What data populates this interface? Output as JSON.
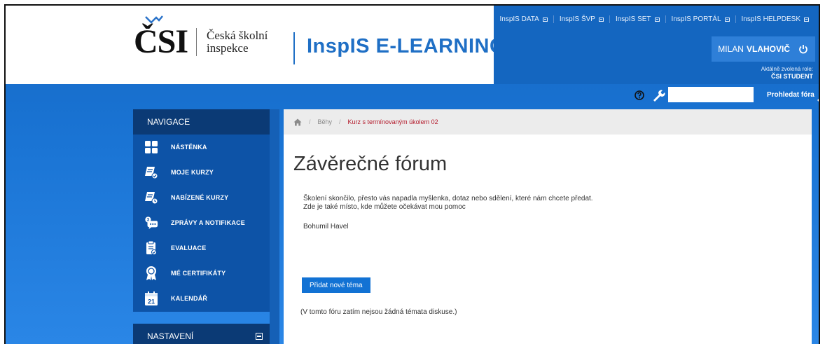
{
  "header": {
    "logo": {
      "mark": "ČSI",
      "line1": "Česká školní",
      "line2": "inspekce"
    },
    "brand": "InspIS E-LEARNING",
    "toplinks": [
      "InspIS DATA",
      "InspIS ŠVP",
      "InspIS SET",
      "InspIS PORTÁL",
      "InspIS HELPDESK"
    ],
    "user": {
      "first": "MILAN",
      "last": "VLAHOVIČ"
    },
    "role_label": "Aktálně zvolená role:",
    "role_value": "ČSI STUDENT"
  },
  "toolbar": {
    "search_placeholder": "",
    "search_button": "Prohledat fóra"
  },
  "sidebar": {
    "nav_title": "NAVIGACE",
    "items": [
      {
        "label": "NÁSTĚNKA",
        "icon": "dashboard-icon"
      },
      {
        "label": "MOJE KURZY",
        "icon": "my-courses-icon"
      },
      {
        "label": "NABÍZENÉ KURZY",
        "icon": "offered-courses-icon"
      },
      {
        "label": "ZPRÁVY A NOTIFIKACE",
        "icon": "messages-icon"
      },
      {
        "label": "EVALUACE",
        "icon": "evaluation-icon"
      },
      {
        "label": "MÉ CERTIFIKÁTY",
        "icon": "certificate-icon"
      },
      {
        "label": "KALENDÁŘ",
        "icon": "calendar-icon",
        "day": "21"
      }
    ],
    "settings_title": "NASTAVENÍ"
  },
  "breadcrumb": {
    "items": [
      "Běhy",
      "Kurz s termínovaným úkolem 02"
    ]
  },
  "main": {
    "title": "Závěrečné fórum",
    "intro_line1": "Školení skončilo, přesto vás napadla myšlenka, dotaz nebo sdělení, které nám chcete předat.",
    "intro_line2": "Zde je také místo, kde můžete očekávat mou pomoc",
    "author": "Bohumil Havel",
    "add_topic": "Přidat nové téma",
    "empty_note": "(V tomto fóru zatím nejsou žádná témata diskuse.)"
  },
  "colors": {
    "accent": "#1272d4",
    "sidebar": "#0d53a7",
    "sidebar_head": "#0b3a75",
    "breadcrumb_current": "#b3192a"
  }
}
